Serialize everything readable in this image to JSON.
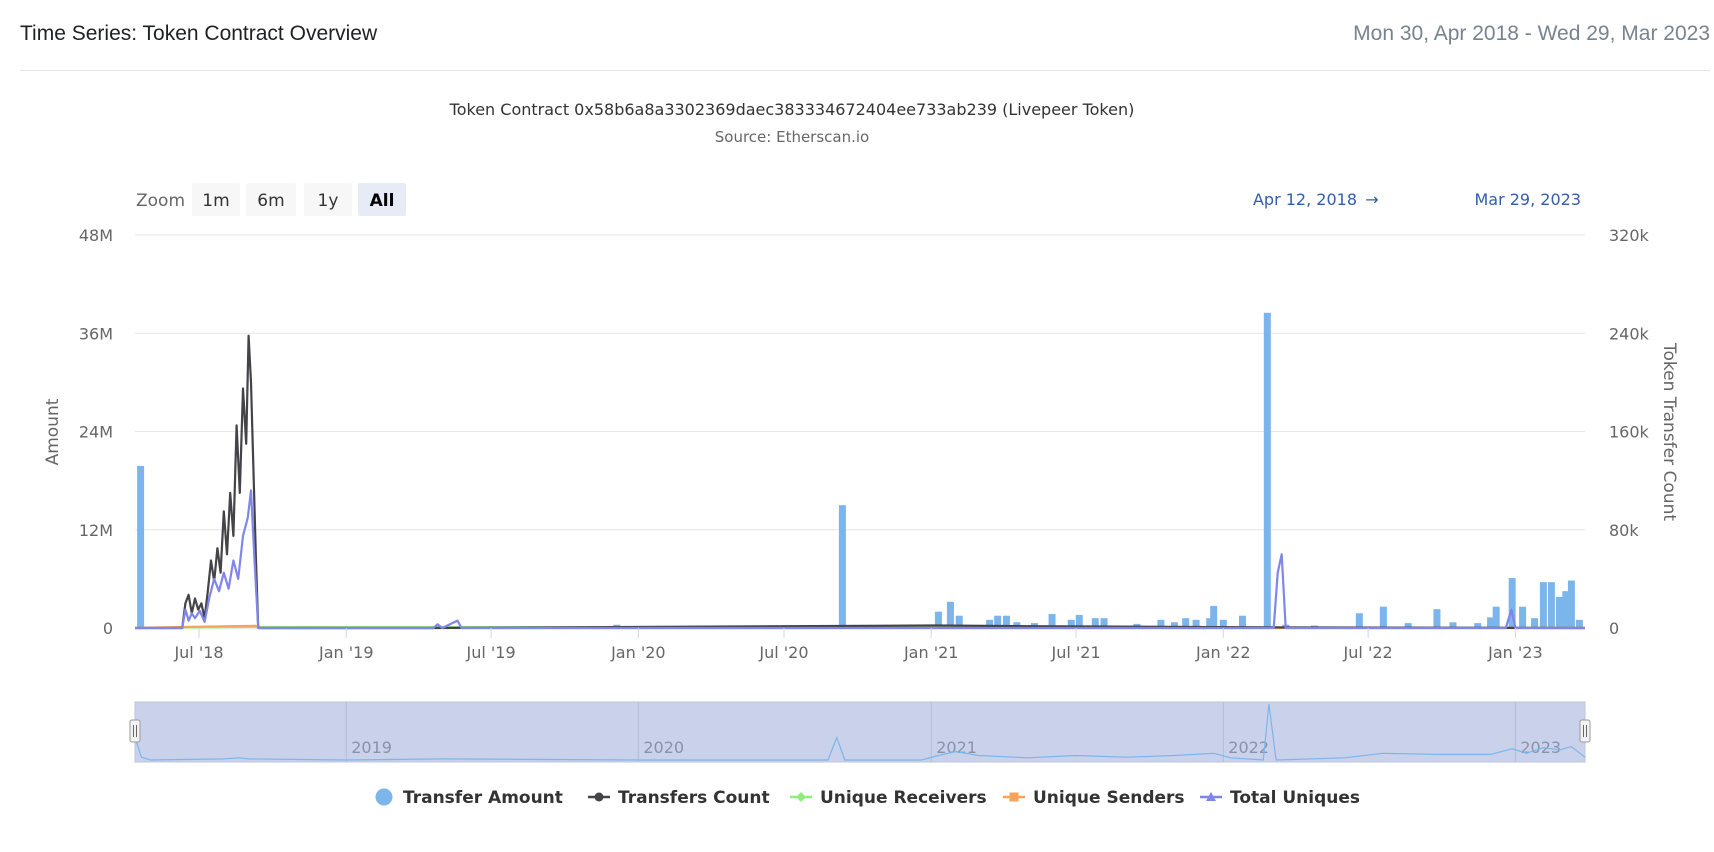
{
  "header": {
    "title": "Time Series: Token Contract Overview",
    "date_range": "Mon 30, Apr 2018 - Wed 29, Mar 2023"
  },
  "colors": {
    "transfer_amount": "#7cb5ec",
    "transfers_count": "#434348",
    "unique_receivers": "#90ed7d",
    "unique_senders": "#f7a35c",
    "total_uniques": "#8085e9",
    "navigator_mask": "#c9d2ea"
  },
  "zoom": {
    "label": "Zoom",
    "buttons": [
      {
        "label": "1m",
        "selected": false
      },
      {
        "label": "6m",
        "selected": false
      },
      {
        "label": "1y",
        "selected": false
      },
      {
        "label": "All",
        "selected": true
      }
    ]
  },
  "range_display": {
    "from": "Apr 12, 2018",
    "arrow": "→",
    "to": "Mar 29, 2023"
  },
  "legend": [
    {
      "label": "Transfer Amount",
      "symbol": "circle",
      "color": "#7cb5ec"
    },
    {
      "label": "Transfers Count",
      "symbol": "line-circle",
      "color": "#434348"
    },
    {
      "label": "Unique Receivers",
      "symbol": "line-diamond",
      "color": "#90ed7d"
    },
    {
      "label": "Unique Senders",
      "symbol": "line-square",
      "color": "#f7a35c"
    },
    {
      "label": "Total Uniques",
      "symbol": "line-triangle",
      "color": "#8085e9"
    }
  ],
  "chart_data": {
    "type": "bar",
    "title": "Token Contract 0x58b6a8a3302369daec383334672404ee733ab239 (Livepeer Token)",
    "subtitle": "Source: Etherscan.io",
    "x_range": [
      "2018-04-12",
      "2023-03-29"
    ],
    "x_ticks": [
      {
        "date": "2018-07-01",
        "label": "Jul '18"
      },
      {
        "date": "2019-01-01",
        "label": "Jan '19"
      },
      {
        "date": "2019-07-01",
        "label": "Jul '19"
      },
      {
        "date": "2020-01-01",
        "label": "Jan '20"
      },
      {
        "date": "2020-07-01",
        "label": "Jul '20"
      },
      {
        "date": "2021-01-01",
        "label": "Jan '21"
      },
      {
        "date": "2021-07-01",
        "label": "Jul '21"
      },
      {
        "date": "2022-01-01",
        "label": "Jan '22"
      },
      {
        "date": "2022-07-01",
        "label": "Jul '22"
      },
      {
        "date": "2023-01-01",
        "label": "Jan '23"
      }
    ],
    "y_left": {
      "label": "Amount",
      "min": 0,
      "max": 48000000,
      "ticks": [
        {
          "value": 0,
          "label": "0"
        },
        {
          "value": 12000000,
          "label": "12M"
        },
        {
          "value": 24000000,
          "label": "24M"
        },
        {
          "value": 36000000,
          "label": "36M"
        },
        {
          "value": 48000000,
          "label": "48M"
        }
      ]
    },
    "y_right": {
      "label": "Token Transfer Count",
      "min": 0,
      "max": 320000,
      "ticks": [
        {
          "value": 0,
          "label": "0"
        },
        {
          "value": 80000,
          "label": "80k"
        },
        {
          "value": 160000,
          "label": "160k"
        },
        {
          "value": 240000,
          "label": "240k"
        },
        {
          "value": 320000,
          "label": "320k"
        }
      ]
    },
    "navigator_years": [
      {
        "date": "2019-01-01",
        "label": "2019"
      },
      {
        "date": "2020-01-01",
        "label": "2020"
      },
      {
        "date": "2021-01-01",
        "label": "2021"
      },
      {
        "date": "2022-01-01",
        "label": "2022"
      },
      {
        "date": "2023-01-01",
        "label": "2023"
      }
    ],
    "series": [
      {
        "name": "Transfer Amount",
        "axis": "left",
        "type": "column",
        "points": [
          [
            "2018-04-19",
            19800000
          ],
          [
            "2018-07-15",
            300000
          ],
          [
            "2018-09-20",
            200000
          ],
          [
            "2019-05-10",
            150000
          ],
          [
            "2019-08-20",
            200000
          ],
          [
            "2019-12-05",
            400000
          ],
          [
            "2020-03-15",
            100000
          ],
          [
            "2020-09-12",
            15000000
          ],
          [
            "2020-10-05",
            300000
          ],
          [
            "2020-12-28",
            400000
          ],
          [
            "2021-01-10",
            2000000
          ],
          [
            "2021-01-25",
            3200000
          ],
          [
            "2021-02-05",
            1500000
          ],
          [
            "2021-03-15",
            1000000
          ],
          [
            "2021-03-25",
            1500000
          ],
          [
            "2021-04-05",
            1500000
          ],
          [
            "2021-04-18",
            700000
          ],
          [
            "2021-05-10",
            600000
          ],
          [
            "2021-06-01",
            1700000
          ],
          [
            "2021-06-25",
            1000000
          ],
          [
            "2021-07-05",
            1600000
          ],
          [
            "2021-07-25",
            1200000
          ],
          [
            "2021-08-05",
            1200000
          ],
          [
            "2021-09-15",
            500000
          ],
          [
            "2021-10-15",
            1000000
          ],
          [
            "2021-11-01",
            700000
          ],
          [
            "2021-11-15",
            1200000
          ],
          [
            "2021-11-28",
            1000000
          ],
          [
            "2021-12-15",
            1200000
          ],
          [
            "2021-12-20",
            2700000
          ],
          [
            "2022-01-01",
            1000000
          ],
          [
            "2022-01-25",
            1500000
          ],
          [
            "2022-02-25",
            38500000
          ],
          [
            "2022-03-20",
            400000
          ],
          [
            "2022-04-25",
            300000
          ],
          [
            "2022-06-20",
            1800000
          ],
          [
            "2022-07-20",
            2600000
          ],
          [
            "2022-08-20",
            600000
          ],
          [
            "2022-09-25",
            2300000
          ],
          [
            "2022-10-15",
            700000
          ],
          [
            "2022-11-15",
            600000
          ],
          [
            "2022-12-01",
            1300000
          ],
          [
            "2022-12-08",
            2600000
          ],
          [
            "2022-12-28",
            6100000
          ],
          [
            "2023-01-10",
            2600000
          ],
          [
            "2023-01-25",
            1200000
          ],
          [
            "2023-02-05",
            5600000
          ],
          [
            "2023-02-15",
            5600000
          ],
          [
            "2023-02-25",
            3800000
          ],
          [
            "2023-03-05",
            4500000
          ],
          [
            "2023-03-12",
            5800000
          ],
          [
            "2023-03-22",
            1000000
          ]
        ]
      },
      {
        "name": "Transfers Count",
        "axis": "right",
        "type": "line",
        "points": [
          [
            "2018-04-12",
            0
          ],
          [
            "2018-06-10",
            0
          ],
          [
            "2018-06-14",
            20000
          ],
          [
            "2018-06-18",
            27000
          ],
          [
            "2018-06-22",
            12000
          ],
          [
            "2018-06-26",
            24000
          ],
          [
            "2018-06-30",
            15000
          ],
          [
            "2018-07-04",
            20000
          ],
          [
            "2018-07-08",
            8000
          ],
          [
            "2018-07-12",
            30000
          ],
          [
            "2018-07-16",
            55000
          ],
          [
            "2018-07-20",
            38000
          ],
          [
            "2018-07-24",
            65000
          ],
          [
            "2018-07-28",
            45000
          ],
          [
            "2018-08-01",
            95000
          ],
          [
            "2018-08-05",
            60000
          ],
          [
            "2018-08-09",
            110000
          ],
          [
            "2018-08-13",
            75000
          ],
          [
            "2018-08-17",
            165000
          ],
          [
            "2018-08-21",
            110000
          ],
          [
            "2018-08-25",
            195000
          ],
          [
            "2018-08-29",
            150000
          ],
          [
            "2018-09-01",
            238000
          ],
          [
            "2018-09-04",
            200000
          ],
          [
            "2018-09-07",
            130000
          ],
          [
            "2018-09-10",
            60000
          ],
          [
            "2018-09-13",
            0
          ],
          [
            "2019-04-10",
            0
          ],
          [
            "2021-01-05",
            2000
          ],
          [
            "2021-05-01",
            1500
          ],
          [
            "2022-03-01",
            500
          ],
          [
            "2023-03-29",
            0
          ]
        ]
      },
      {
        "name": "Unique Receivers",
        "axis": "right",
        "type": "line",
        "points": [
          [
            "2018-04-12",
            0
          ],
          [
            "2018-09-01",
            800
          ],
          [
            "2023-03-29",
            0
          ]
        ]
      },
      {
        "name": "Unique Senders",
        "axis": "right",
        "type": "line",
        "points": [
          [
            "2018-04-12",
            0
          ],
          [
            "2018-06-20",
            1000
          ],
          [
            "2018-09-10",
            1800
          ],
          [
            "2018-09-15",
            0
          ],
          [
            "2023-03-29",
            0
          ]
        ]
      },
      {
        "name": "Total Uniques",
        "axis": "right",
        "type": "line",
        "points": [
          [
            "2018-04-12",
            0
          ],
          [
            "2018-06-10",
            0
          ],
          [
            "2018-06-14",
            15000
          ],
          [
            "2018-06-18",
            6000
          ],
          [
            "2018-06-22",
            12000
          ],
          [
            "2018-06-26",
            8000
          ],
          [
            "2018-07-02",
            14000
          ],
          [
            "2018-07-08",
            5000
          ],
          [
            "2018-07-14",
            25000
          ],
          [
            "2018-07-20",
            40000
          ],
          [
            "2018-07-26",
            30000
          ],
          [
            "2018-08-01",
            45000
          ],
          [
            "2018-08-07",
            32000
          ],
          [
            "2018-08-13",
            55000
          ],
          [
            "2018-08-19",
            40000
          ],
          [
            "2018-08-25",
            75000
          ],
          [
            "2018-08-31",
            90000
          ],
          [
            "2018-09-04",
            112000
          ],
          [
            "2018-09-08",
            60000
          ],
          [
            "2018-09-13",
            0
          ],
          [
            "2019-04-20",
            0
          ],
          [
            "2019-04-25",
            3000
          ],
          [
            "2019-05-01",
            0
          ],
          [
            "2019-05-20",
            6000
          ],
          [
            "2019-05-25",
            0
          ],
          [
            "2022-03-05",
            0
          ],
          [
            "2022-03-10",
            45000
          ],
          [
            "2022-03-15",
            60000
          ],
          [
            "2022-03-20",
            0
          ],
          [
            "2022-12-20",
            0
          ],
          [
            "2022-12-27",
            15000
          ],
          [
            "2023-01-01",
            0
          ],
          [
            "2023-03-29",
            0
          ]
        ]
      }
    ],
    "navigator_series": [
      [
        "2018-04-12",
        0.4
      ],
      [
        "2018-04-20",
        0.05
      ],
      [
        "2018-05-01",
        0
      ],
      [
        "2018-08-01",
        0.02
      ],
      [
        "2018-08-20",
        0.04
      ],
      [
        "2018-09-01",
        0.02
      ],
      [
        "2019-01-01",
        0
      ],
      [
        "2019-05-01",
        0.02
      ],
      [
        "2020-01-01",
        0
      ],
      [
        "2020-08-25",
        0
      ],
      [
        "2020-09-05",
        0.4
      ],
      [
        "2020-09-15",
        0
      ],
      [
        "2020-12-20",
        0
      ],
      [
        "2021-01-10",
        0.08
      ],
      [
        "2021-02-01",
        0.15
      ],
      [
        "2021-03-01",
        0.08
      ],
      [
        "2021-05-01",
        0.04
      ],
      [
        "2021-07-01",
        0.08
      ],
      [
        "2021-09-01",
        0.05
      ],
      [
        "2021-11-01",
        0.08
      ],
      [
        "2021-12-20",
        0.12
      ],
      [
        "2022-01-10",
        0.04
      ],
      [
        "2022-02-20",
        0
      ],
      [
        "2022-02-27",
        1.0
      ],
      [
        "2022-03-08",
        0
      ],
      [
        "2022-06-01",
        0.04
      ],
      [
        "2022-07-20",
        0.12
      ],
      [
        "2022-09-25",
        0.1
      ],
      [
        "2022-12-01",
        0.1
      ],
      [
        "2022-12-28",
        0.2
      ],
      [
        "2023-01-15",
        0.12
      ],
      [
        "2023-02-05",
        0.22
      ],
      [
        "2023-02-25",
        0.18
      ],
      [
        "2023-03-12",
        0.24
      ],
      [
        "2023-03-29",
        0.05
      ]
    ]
  }
}
